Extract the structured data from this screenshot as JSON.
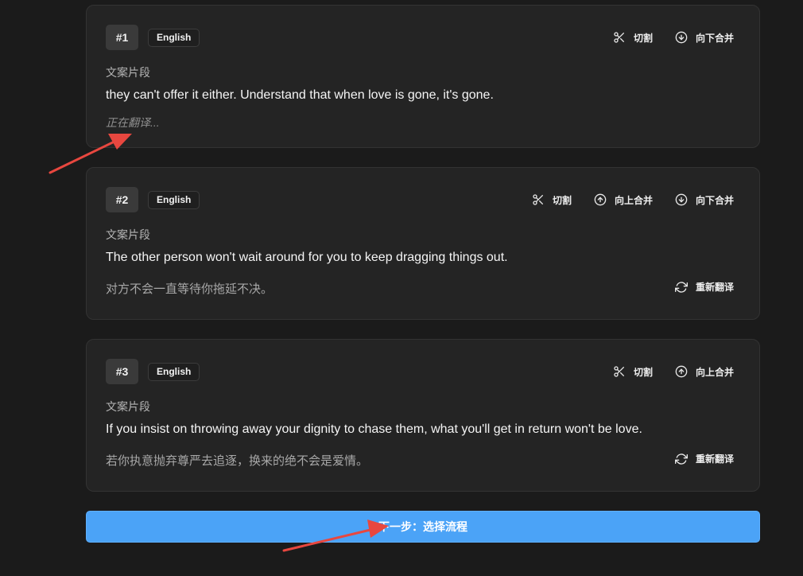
{
  "segments": [
    {
      "number": "#1",
      "language": "English",
      "actions": [
        "切割",
        "向下合并"
      ],
      "label": "文案片段",
      "source": "they can't offer it either. Understand that when love is gone, it's gone.",
      "translation": "正在翻译..."
    },
    {
      "number": "#2",
      "language": "English",
      "actions": [
        "切割",
        "向上合并",
        "向下合并"
      ],
      "label": "文案片段",
      "source": "The other person won't wait around for you to keep dragging things out.",
      "translation": "对方不会一直等待你拖延不决。",
      "retranslate": "重新翻译"
    },
    {
      "number": "#3",
      "language": "English",
      "actions": [
        "切割",
        "向上合并"
      ],
      "label": "文案片段",
      "source": "If you insist on throwing away your dignity to chase them, what you'll get in return won't be love.",
      "translation": "若你执意抛弃尊严去追逐，换来的绝不会是爱情。",
      "retranslate": "重新翻译"
    }
  ],
  "next_button": "下一步：选择流程",
  "icons": {
    "cut": "scissors-icon",
    "merge_up": "arrow-up-circle-icon",
    "merge_down": "arrow-down-circle-icon",
    "retranslate": "refresh-icon"
  },
  "colors": {
    "background": "#1b1b1b",
    "card": "#242424",
    "accent": "#4ba3f7",
    "annotation_arrow": "#e8473f"
  }
}
